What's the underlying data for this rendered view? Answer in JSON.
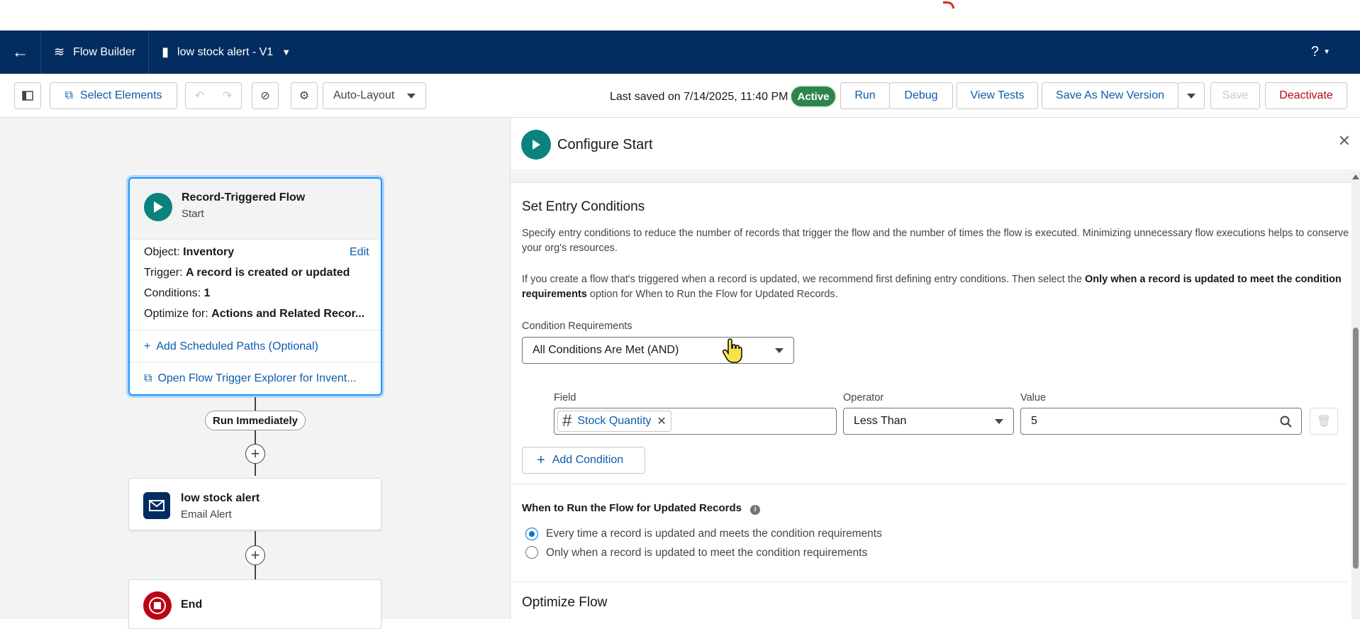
{
  "header": {
    "app_name": "Flow Builder",
    "flow_name": "low stock alert - V1",
    "help": "?"
  },
  "toolbar": {
    "select_elements": "Select Elements",
    "layout": "Auto-Layout",
    "last_saved": "Last saved on 7/14/2025, 11:40 PM",
    "status": "Active",
    "run": "Run",
    "debug": "Debug",
    "view_tests": "View Tests",
    "save_new_version": "Save As New Version",
    "save": "Save",
    "deactivate": "Deactivate"
  },
  "canvas": {
    "start": {
      "title": "Record-Triggered Flow",
      "subtitle": "Start",
      "object_label": "Object:",
      "object_value": "Inventory",
      "edit": "Edit",
      "trigger_label": "Trigger:",
      "trigger_value": "A record is created or updated",
      "conditions_label": "Conditions:",
      "conditions_value": "1",
      "optimize_label": "Optimize for:",
      "optimize_value": "Actions and Related Recor...",
      "add_paths": "Add Scheduled Paths (Optional)",
      "open_explorer": "Open Flow Trigger Explorer for Invent..."
    },
    "run_immediately": "Run Immediately",
    "email_node": {
      "title": "low stock alert",
      "subtitle": "Email Alert"
    },
    "end_node": {
      "title": "End"
    }
  },
  "panel": {
    "title": "Configure Start",
    "section_title": "Set Entry Conditions",
    "para1": "Specify entry conditions to reduce the number of records that trigger the flow and the number of times the flow is executed. Minimizing unnecessary flow executions helps to conserve your org's resources.",
    "para2_a": "If you create a flow that's triggered when a record is updated, we recommend first defining entry conditions. Then select the ",
    "para2_b": "Only when a record is updated to meet the condition requirements",
    "para2_c": " option for When to Run the Flow for Updated Records.",
    "cond_req_label": "Condition Requirements",
    "cond_req_value": "All Conditions Are Met (AND)",
    "field_label": "Field",
    "field_value": "Stock Quantity",
    "operator_label": "Operator",
    "operator_value": "Less Than",
    "value_label": "Value",
    "value_value": "5",
    "add_condition": "Add Condition",
    "when_title": "When to Run the Flow for Updated Records",
    "radio1": "Every time a record is updated and meets the condition requirements",
    "radio2": "Only when a record is updated to meet the condition requirements",
    "optimize_title": "Optimize Flow"
  },
  "colors": {
    "header_bg": "#032d60",
    "brand_blue": "#0b5cab",
    "active_green": "#2e844a",
    "start_teal": "#0b827c",
    "email_navy": "#032d60",
    "end_red": "#ba0517",
    "deactivate_red": "#ba0517"
  }
}
